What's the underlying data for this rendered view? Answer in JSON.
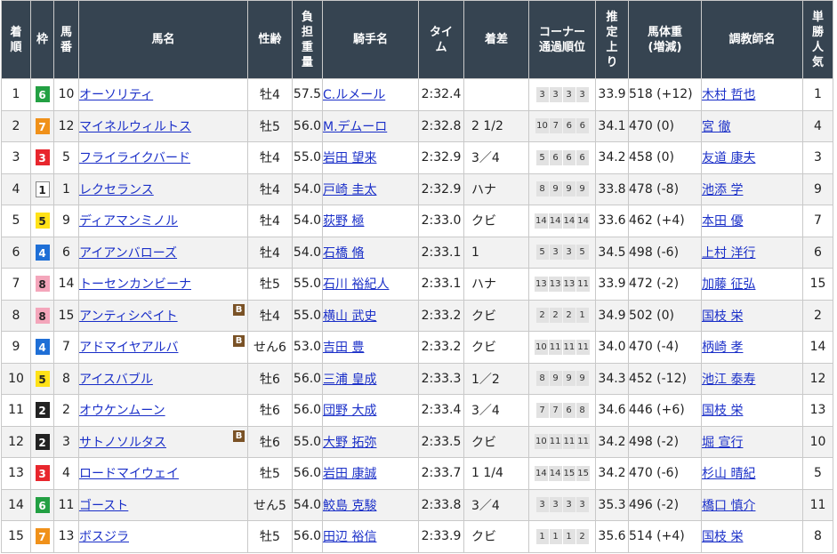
{
  "headers": {
    "finish": "着順",
    "frame": "枠",
    "number": "馬番",
    "horse": "馬名",
    "sexage": "性齢",
    "burden": "負担重量",
    "jockey": "騎手名",
    "time": "タイム",
    "margin": "着差",
    "corner": "コーナー通過順位",
    "last": "推定上り",
    "weight": "馬体重(増減)",
    "trainer": "調教師名",
    "pop": "単勝人気"
  },
  "colors": {
    "header_bg": "#364451",
    "link": "#1a2fc8",
    "blinker": "#7a5226",
    "frame_1": "#ffffff",
    "frame_2": "#222222",
    "frame_3": "#e8262d",
    "frame_4": "#1f6fd6",
    "frame_5": "#ffe218",
    "frame_6": "#23a043",
    "frame_7": "#f0911a",
    "frame_8": "#f4a6bb"
  },
  "blinker_label": "B",
  "rows": [
    {
      "finish": "1",
      "frame": "6",
      "number": "10",
      "horse": "オーソリティ",
      "blinker": false,
      "sexage": "牡4",
      "burden": "57.5",
      "jockey": "C.ルメール",
      "time": "2:32.4",
      "margin": "",
      "passes": [
        "3",
        "3",
        "3",
        "3"
      ],
      "last": "33.9",
      "weight": "518 (+12)",
      "trainer": "木村 哲也",
      "pop": "1"
    },
    {
      "finish": "2",
      "frame": "7",
      "number": "12",
      "horse": "マイネルウィルトス",
      "blinker": false,
      "sexage": "牡5",
      "burden": "56.0",
      "jockey": "M.デムーロ",
      "time": "2:32.8",
      "margin": "2 1/2",
      "passes": [
        "10",
        "7",
        "6",
        "6"
      ],
      "last": "34.1",
      "weight": "470 (0)",
      "trainer": "宮 徹",
      "pop": "4"
    },
    {
      "finish": "3",
      "frame": "3",
      "number": "5",
      "horse": "フライライクバード",
      "blinker": false,
      "sexage": "牡4",
      "burden": "55.0",
      "jockey": "岩田 望来",
      "time": "2:32.9",
      "margin": "3／4",
      "passes": [
        "5",
        "6",
        "6",
        "6"
      ],
      "last": "34.2",
      "weight": "458 (0)",
      "trainer": "友道 康夫",
      "pop": "3"
    },
    {
      "finish": "4",
      "frame": "1",
      "number": "1",
      "horse": "レクセランス",
      "blinker": false,
      "sexage": "牡4",
      "burden": "54.0",
      "jockey": "戸崎 圭太",
      "time": "2:32.9",
      "margin": "ハナ",
      "passes": [
        "8",
        "9",
        "9",
        "9"
      ],
      "last": "33.8",
      "weight": "478 (-8)",
      "trainer": "池添 学",
      "pop": "9"
    },
    {
      "finish": "5",
      "frame": "5",
      "number": "9",
      "horse": "ディアマンミノル",
      "blinker": false,
      "sexage": "牡4",
      "burden": "54.0",
      "jockey": "荻野 極",
      "time": "2:33.0",
      "margin": "クビ",
      "passes": [
        "14",
        "14",
        "14",
        "14"
      ],
      "last": "33.6",
      "weight": "462 (+4)",
      "trainer": "本田 優",
      "pop": "7"
    },
    {
      "finish": "6",
      "frame": "4",
      "number": "6",
      "horse": "アイアンバローズ",
      "blinker": false,
      "sexage": "牡4",
      "burden": "54.0",
      "jockey": "石橋 脩",
      "time": "2:33.1",
      "margin": "1",
      "passes": [
        "5",
        "3",
        "3",
        "5"
      ],
      "last": "34.5",
      "weight": "498 (-6)",
      "trainer": "上村 洋行",
      "pop": "6"
    },
    {
      "finish": "7",
      "frame": "8",
      "number": "14",
      "horse": "トーセンカンビーナ",
      "blinker": false,
      "sexage": "牡5",
      "burden": "55.0",
      "jockey": "石川 裕紀人",
      "time": "2:33.1",
      "margin": "ハナ",
      "passes": [
        "13",
        "13",
        "13",
        "11"
      ],
      "last": "33.9",
      "weight": "472 (-2)",
      "trainer": "加藤 征弘",
      "pop": "15"
    },
    {
      "finish": "8",
      "frame": "8",
      "number": "15",
      "horse": "アンティシペイト",
      "blinker": true,
      "sexage": "牡4",
      "burden": "55.0",
      "jockey": "横山 武史",
      "time": "2:33.2",
      "margin": "クビ",
      "passes": [
        "2",
        "2",
        "2",
        "1"
      ],
      "last": "34.9",
      "weight": "502 (0)",
      "trainer": "国枝 栄",
      "pop": "2"
    },
    {
      "finish": "9",
      "frame": "4",
      "number": "7",
      "horse": "アドマイヤアルバ",
      "blinker": true,
      "sexage": "せん6",
      "burden": "53.0",
      "jockey": "吉田 豊",
      "time": "2:33.2",
      "margin": "クビ",
      "passes": [
        "10",
        "11",
        "11",
        "11"
      ],
      "last": "34.0",
      "weight": "470 (-4)",
      "trainer": "柄崎 孝",
      "pop": "14"
    },
    {
      "finish": "10",
      "frame": "5",
      "number": "8",
      "horse": "アイスバブル",
      "blinker": false,
      "sexage": "牡6",
      "burden": "56.0",
      "jockey": "三浦 皇成",
      "time": "2:33.3",
      "margin": "1／2",
      "passes": [
        "8",
        "9",
        "9",
        "9"
      ],
      "last": "34.3",
      "weight": "452 (-12)",
      "trainer": "池江 泰寿",
      "pop": "12"
    },
    {
      "finish": "11",
      "frame": "2",
      "number": "2",
      "horse": "オウケンムーン",
      "blinker": false,
      "sexage": "牡6",
      "burden": "56.0",
      "jockey": "団野 大成",
      "time": "2:33.4",
      "margin": "3／4",
      "passes": [
        "7",
        "7",
        "6",
        "8"
      ],
      "last": "34.6",
      "weight": "446 (+6)",
      "trainer": "国枝 栄",
      "pop": "13"
    },
    {
      "finish": "12",
      "frame": "2",
      "number": "3",
      "horse": "サトノソルタス",
      "blinker": true,
      "sexage": "牡6",
      "burden": "55.0",
      "jockey": "大野 拓弥",
      "time": "2:33.5",
      "margin": "クビ",
      "passes": [
        "10",
        "11",
        "11",
        "11"
      ],
      "last": "34.2",
      "weight": "498 (-2)",
      "trainer": "堀 宣行",
      "pop": "10"
    },
    {
      "finish": "13",
      "frame": "3",
      "number": "4",
      "horse": "ロードマイウェイ",
      "blinker": false,
      "sexage": "牡5",
      "burden": "56.0",
      "jockey": "岩田 康誠",
      "time": "2:33.7",
      "margin": "1 1/4",
      "passes": [
        "14",
        "14",
        "15",
        "15"
      ],
      "last": "34.2",
      "weight": "470 (-6)",
      "trainer": "杉山 晴紀",
      "pop": "5"
    },
    {
      "finish": "14",
      "frame": "6",
      "number": "11",
      "horse": "ゴースト",
      "blinker": false,
      "sexage": "せん5",
      "burden": "54.0",
      "jockey": "鮫島 克駿",
      "time": "2:33.8",
      "margin": "3／4",
      "passes": [
        "3",
        "3",
        "3",
        "3"
      ],
      "last": "35.3",
      "weight": "496 (-2)",
      "trainer": "橋口 慎介",
      "pop": "11"
    },
    {
      "finish": "15",
      "frame": "7",
      "number": "13",
      "horse": "ボスジラ",
      "blinker": false,
      "sexage": "牡5",
      "burden": "56.0",
      "jockey": "田辺 裕信",
      "time": "2:33.9",
      "margin": "クビ",
      "passes": [
        "1",
        "1",
        "1",
        "2"
      ],
      "last": "35.6",
      "weight": "514 (+4)",
      "trainer": "国枝 栄",
      "pop": "8"
    }
  ]
}
